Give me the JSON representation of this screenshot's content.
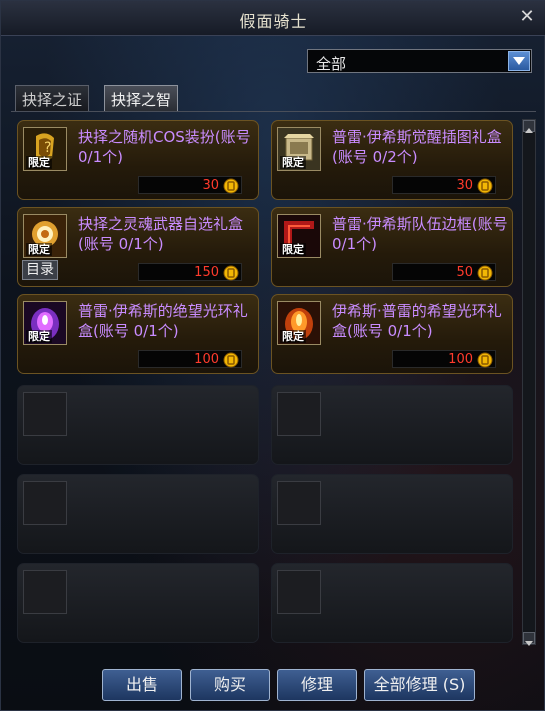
{
  "window": {
    "title": "假面骑士"
  },
  "filter": {
    "selected": "全部"
  },
  "tabs": [
    {
      "label": "抉择之证"
    },
    {
      "label": "抉择之智"
    }
  ],
  "items": [
    {
      "name": "抉择之随机COS装扮(账号 0/1个)",
      "badge": "限定",
      "price": "30",
      "icon": "mask-gold-icon"
    },
    {
      "name": "普雷·伊希斯觉醒插图礼盒(账号 0/2个)",
      "badge": "限定",
      "price": "30",
      "icon": "illustration-box-icon"
    },
    {
      "name": "抉择之灵魂武器自选礼盒(账号 0/1个)",
      "badge": "限定",
      "price": "150",
      "icon": "weapon-box-icon"
    },
    {
      "name": "普雷·伊希斯队伍边框(账号 0/1个)",
      "badge": "限定",
      "price": "50",
      "icon": "red-frame-icon"
    },
    {
      "name": "普雷·伊希斯的绝望光环礼盒(账号 0/1个)",
      "badge": "限定",
      "price": "100",
      "icon": "purple-aura-icon"
    },
    {
      "name": "伊希斯·普雷的希望光环礼盒(账号 0/1个)",
      "badge": "限定",
      "price": "100",
      "icon": "orange-aura-icon"
    }
  ],
  "catalog_tag": "目录",
  "buttons": {
    "sell": "出售",
    "buy": "购买",
    "repair": "修理",
    "repair_all": "全部修理 (S)"
  },
  "colors": {
    "item_name": "#c98cff",
    "price": "#ff3b2c",
    "slot_filled": "#3b2d12",
    "button": "#2b4a7e"
  }
}
